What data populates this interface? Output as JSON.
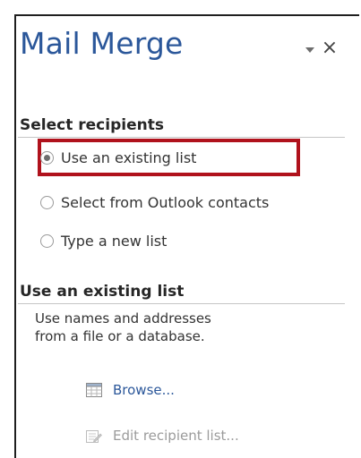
{
  "pane": {
    "title": "Mail Merge",
    "colors": {
      "title": "#2b579a",
      "highlight": "#b0121c",
      "link": "#2b579a",
      "disabled": "#9b9b9b"
    }
  },
  "select_recipients": {
    "heading": "Select recipients",
    "options": [
      {
        "label": "Use an existing list",
        "checked": true
      },
      {
        "label": "Select from Outlook contacts",
        "checked": false
      },
      {
        "label": "Type a new list",
        "checked": false
      }
    ]
  },
  "existing_list": {
    "heading": "Use an existing list",
    "description": [
      "Use names and addresses",
      "from a file or a database."
    ],
    "browse_label": "Browse...",
    "edit_label": "Edit recipient list..."
  }
}
